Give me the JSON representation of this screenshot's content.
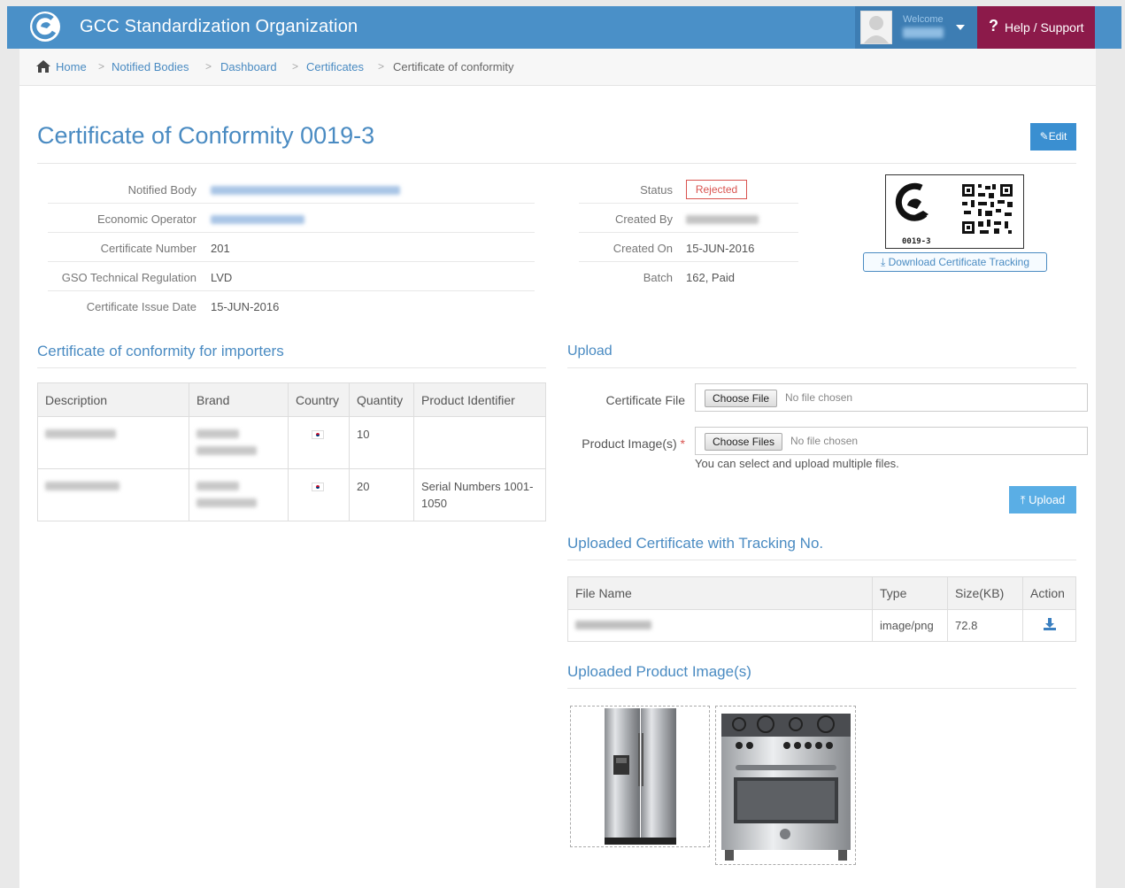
{
  "header": {
    "app_title": "GCC Standardization Organization",
    "welcome": "Welcome",
    "help_label": "Help / Support"
  },
  "breadcrumb": [
    "Home",
    "Notified Bodies",
    "Dashboard",
    "Certificates",
    "Certificate of conformity"
  ],
  "page": {
    "title": "Certificate of Conformity 0019-3",
    "edit_label": "Edit"
  },
  "details_left": [
    {
      "label": "Notified Body",
      "value": ""
    },
    {
      "label": "Economic Operator",
      "value": ""
    },
    {
      "label": "Certificate Number",
      "value": "201"
    },
    {
      "label": "GSO Technical Regulation",
      "value": "LVD"
    },
    {
      "label": "Certificate Issue Date",
      "value": "15-JUN-2016"
    }
  ],
  "details_right": [
    {
      "label": "Status",
      "value": "Rejected"
    },
    {
      "label": "Created By",
      "value": ""
    },
    {
      "label": "Created On",
      "value": "15-JUN-2016"
    },
    {
      "label": "Batch",
      "value": "162, Paid"
    }
  ],
  "tracking": {
    "code": "0019-3",
    "download_label": "Download Certificate Tracking"
  },
  "importers": {
    "section_title": "Certificate of conformity for importers",
    "columns": [
      "Description",
      "Brand",
      "Country",
      "Quantity",
      "Product Identifier"
    ],
    "rows": [
      {
        "quantity": "10",
        "identifier": ""
      },
      {
        "quantity": "20",
        "identifier": "Serial Numbers 1001-1050"
      }
    ]
  },
  "upload": {
    "section_title": "Upload",
    "certificate_label": "Certificate File",
    "images_label": "Product Image(s)",
    "required_mark": "*",
    "choose_file": "Choose File",
    "choose_files": "Choose Files",
    "no_file": "No file chosen",
    "help_text": "You can select and upload multiple files.",
    "upload_label": "Upload"
  },
  "uploaded_cert": {
    "section_title": "Uploaded Certificate with Tracking No.",
    "columns": [
      "File Name",
      "Type",
      "Size(KB)",
      "Action"
    ],
    "rows": [
      {
        "type": "image/png",
        "size": "72.8"
      }
    ]
  },
  "product_images": {
    "section_title": "Uploaded Product Image(s)"
  },
  "colors": {
    "topbar": "#4a90c8",
    "help": "#8c1a4a",
    "accent": "#4a8bc2",
    "rejected": "#d9534f"
  }
}
